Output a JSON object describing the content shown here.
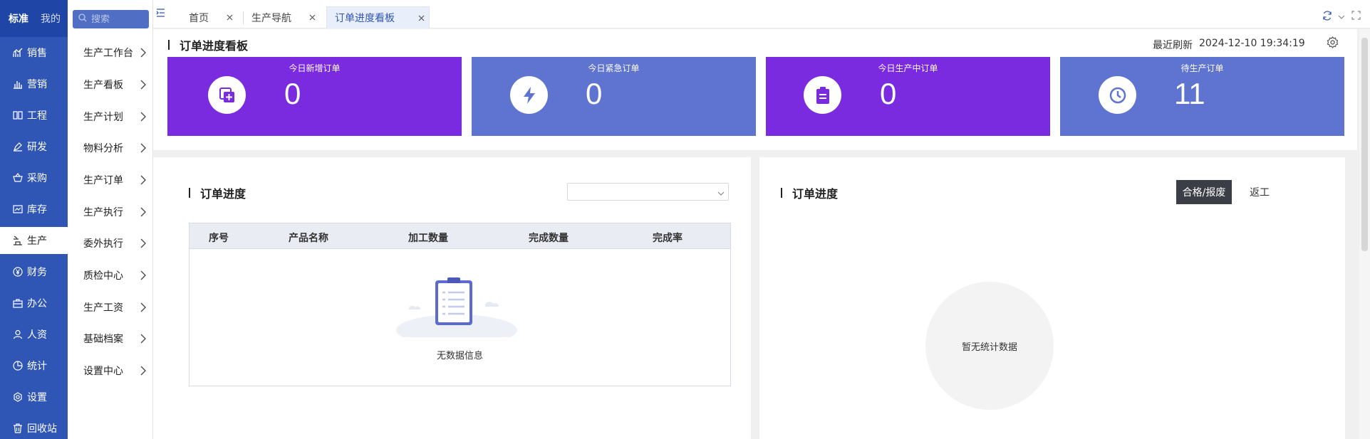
{
  "nav": {
    "tabs": [
      {
        "label": "标准"
      },
      {
        "label": "我的"
      }
    ],
    "items": [
      {
        "label": "销售",
        "icon": "chart-line-icon"
      },
      {
        "label": "营销",
        "icon": "bar-chart-icon"
      },
      {
        "label": "工程",
        "icon": "book-icon"
      },
      {
        "label": "研发",
        "icon": "pen-icon"
      },
      {
        "label": "采购",
        "icon": "basket-icon"
      },
      {
        "label": "库存",
        "icon": "warehouse-icon"
      },
      {
        "label": "生产",
        "icon": "factory-icon",
        "active": true
      },
      {
        "label": "财务",
        "icon": "yen-icon"
      },
      {
        "label": "办公",
        "icon": "briefcase-icon"
      },
      {
        "label": "人资",
        "icon": "user-icon"
      },
      {
        "label": "统计",
        "icon": "pie-icon"
      },
      {
        "label": "设置",
        "icon": "gear-icon"
      },
      {
        "label": "回收站",
        "icon": "trash-icon"
      }
    ]
  },
  "search": {
    "placeholder": "搜索"
  },
  "submenu": [
    {
      "label": "生产工作台"
    },
    {
      "label": "生产看板"
    },
    {
      "label": "生产计划"
    },
    {
      "label": "物料分析"
    },
    {
      "label": "生产订单"
    },
    {
      "label": "生产执行"
    },
    {
      "label": "委外执行"
    },
    {
      "label": "质检中心"
    },
    {
      "label": "生产工资"
    },
    {
      "label": "基础档案"
    },
    {
      "label": "设置中心"
    }
  ],
  "tabs": [
    {
      "label": "首页"
    },
    {
      "label": "生产导航"
    },
    {
      "label": "订单进度看板",
      "active": true
    }
  ],
  "header": {
    "title": "订单进度看板",
    "refresh_label": "最近刷新",
    "refresh_time": "2024-12-10 19:34:19"
  },
  "cards": [
    {
      "label": "今日新增订单",
      "value": "0",
      "icon": "add-copy-icon",
      "color": "#7a2be0"
    },
    {
      "label": "今日紧急订单",
      "value": "0",
      "icon": "lightning-icon",
      "color": "#5e74d0"
    },
    {
      "label": "今日生产中订单",
      "value": "0",
      "icon": "clipboard-icon",
      "color": "#7a2be0"
    },
    {
      "label": "待生产订单",
      "value": "11",
      "icon": "clock-icon",
      "color": "#5e74d0"
    }
  ],
  "left_panel": {
    "title": "订单进度",
    "columns": [
      "序号",
      "产品名称",
      "加工数量",
      "完成数量",
      "完成率"
    ],
    "empty_text": "无数据信息"
  },
  "right_panel": {
    "title": "订单进度",
    "btn_pass": "合格/报废",
    "btn_rework": "返工",
    "empty_text": "暂无统计数据"
  },
  "colors": {
    "nav_bg": "#2f55b5",
    "accent_purple": "#7a2be0",
    "accent_blue": "#5e74d0"
  }
}
